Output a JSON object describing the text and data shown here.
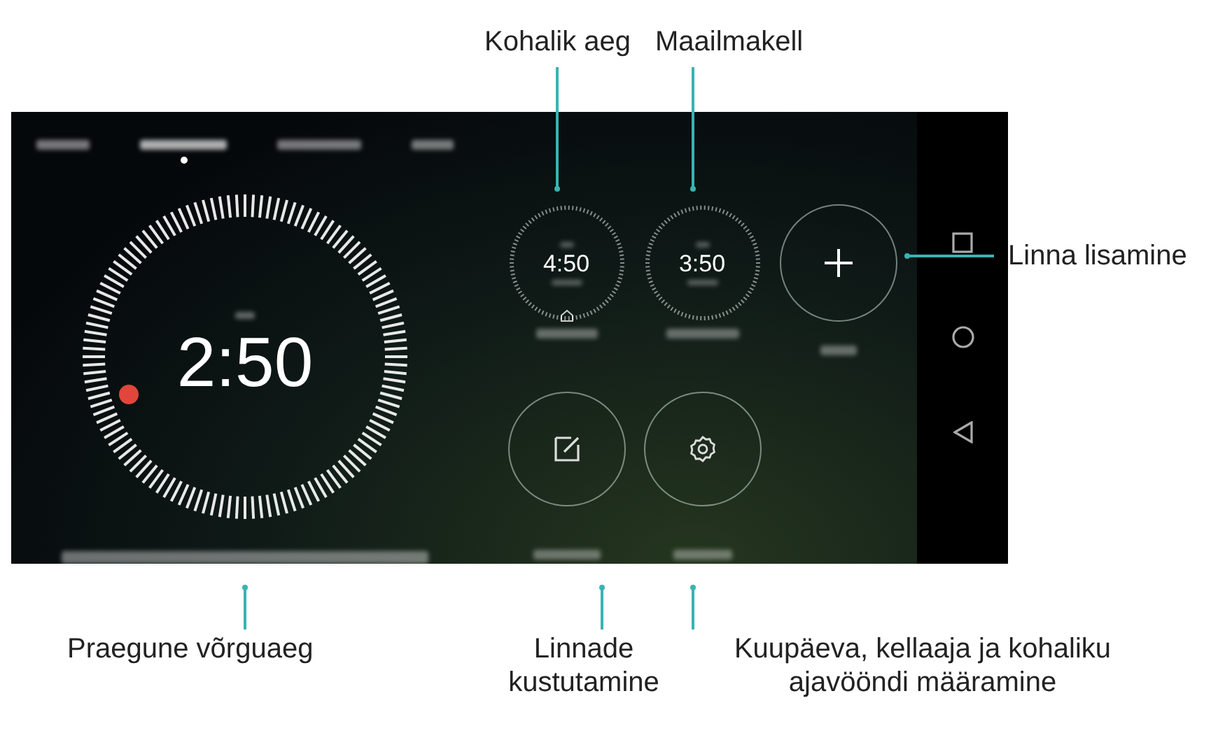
{
  "tabs": [
    {
      "selected": false
    },
    {
      "selected": true
    },
    {
      "selected": false
    },
    {
      "selected": false
    }
  ],
  "main_clock": {
    "time": "2:50"
  },
  "cities": [
    {
      "time": "4:50",
      "home": true
    },
    {
      "time": "3:50",
      "home": false
    }
  ],
  "actions": [
    {
      "kind": "add"
    },
    {
      "kind": "edit"
    },
    {
      "kind": "settings"
    }
  ],
  "nav_buttons": [
    {
      "kind": "recent"
    },
    {
      "kind": "home"
    },
    {
      "kind": "back"
    }
  ],
  "callouts": [
    {
      "text": "Kohalik aeg"
    },
    {
      "text": "Maailmakell"
    },
    {
      "text": "Linna lisamine"
    },
    {
      "text": "Praegune võrguaeg"
    },
    {
      "text": "Linnade kustutamine"
    },
    {
      "text": "Kuupäeva, kellaaja ja kohaliku ajavööndi määramine"
    }
  ]
}
